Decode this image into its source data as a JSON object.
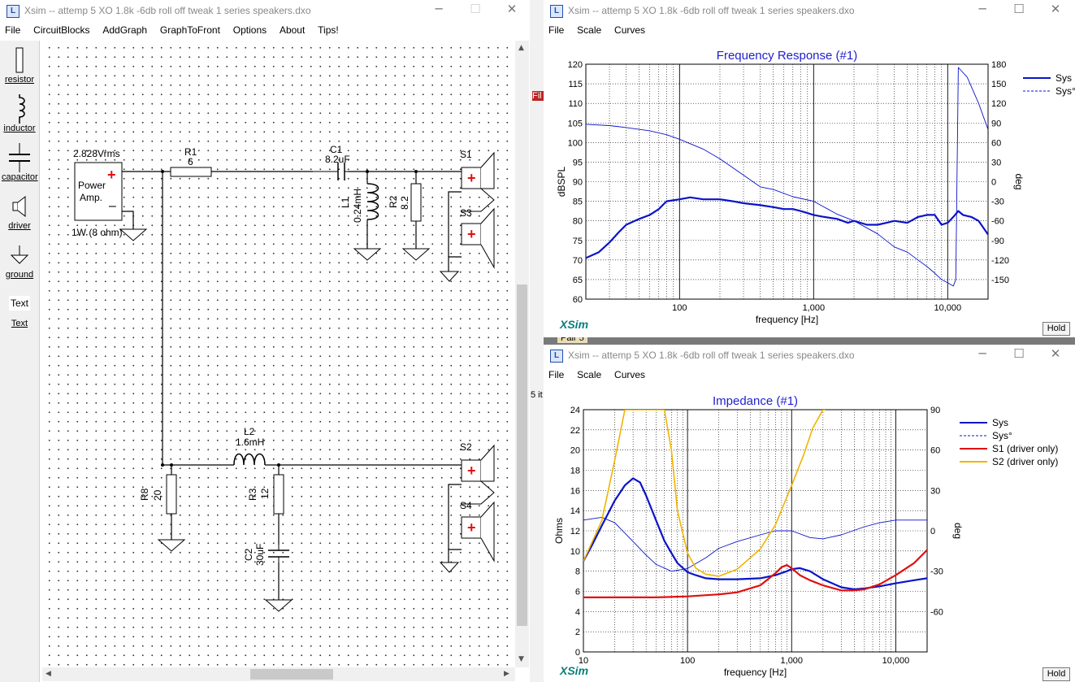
{
  "schematic_window": {
    "title": "Xsim -- attemp 5 XO 1.8k -6db roll off tweak 1 series speakers.dxo",
    "menu": [
      "File",
      "CircuitBlocks",
      "AddGraph",
      "GraphToFront",
      "Options",
      "About",
      "Tips!"
    ],
    "tools": [
      {
        "label": "resistor",
        "icon": "resistor-icon"
      },
      {
        "label": "inductor",
        "icon": "inductor-icon"
      },
      {
        "label": "capacitor",
        "icon": "capacitor-icon"
      },
      {
        "label": "driver",
        "icon": "driver-icon"
      },
      {
        "label": "ground",
        "icon": "ground-icon"
      },
      {
        "label": "Text",
        "icon": "text-icon"
      }
    ],
    "tools_extra_label": "Text",
    "circuit": {
      "source": {
        "voltage": "2.828Vrms",
        "name_line1": "Power",
        "name_line2": "Amp.",
        "power": "1W (8 ohm)"
      },
      "R1": {
        "name": "R1",
        "value": "6"
      },
      "C1": {
        "name": "C1",
        "value": "8.2uF"
      },
      "L1": {
        "name": "L1",
        "value": "0.24mH"
      },
      "R2": {
        "name": "R2",
        "value": "8.2"
      },
      "S1": "S1",
      "S3": "S3",
      "L2": {
        "name": "L2",
        "value": "1.6mH"
      },
      "R8": {
        "name": "R8",
        "value": "20"
      },
      "R3": {
        "name": "R3",
        "value": "12"
      },
      "C2": {
        "name": "C2",
        "value": "30uF"
      },
      "S2": "S2",
      "S4": "S4"
    }
  },
  "freq_window": {
    "title": "Xsim -- attemp 5 XO 1.8k -6db roll off tweak 1 series speakers.dxo",
    "menu": [
      "File",
      "Scale",
      "Curves"
    ],
    "hold": "Hold",
    "brand": "XSim"
  },
  "imp_window": {
    "title": "Xsim -- attemp 5 XO 1.8k -6db roll off tweak 1 series speakers.dxo",
    "menu": [
      "File",
      "Scale",
      "Curves"
    ],
    "hold": "Hold",
    "brand": "XSim"
  },
  "background_peek": {
    "a": "Fil",
    "b": "Pair 5",
    "c": "5 it"
  },
  "colors": {
    "blue": "#0a14c8",
    "red": "#e01010",
    "orange": "#f0b400",
    "title_blue": "#1e1ed0"
  },
  "chart_data": [
    {
      "type": "line",
      "title": "Frequency Response (#1)",
      "xlabel": "frequency [Hz]",
      "ylabel": "dBSPL",
      "y2label": "deg",
      "x_scale": "log",
      "xlim": [
        20,
        20000
      ],
      "ylim": [
        60,
        120
      ],
      "y2lim": [
        -180,
        180
      ],
      "x_ticks": [
        "100",
        "1,000",
        "10,000"
      ],
      "y_ticks": [
        "120",
        "115",
        "110",
        "105",
        "100",
        "95",
        "90",
        "85",
        "80",
        "75",
        "70",
        "65",
        "60"
      ],
      "y2_ticks": [
        "180",
        "150",
        "120",
        "90",
        "60",
        "30",
        "0",
        "-30",
        "-60",
        "-90",
        "-120",
        "-150"
      ],
      "grid": true,
      "legend": "top-right",
      "series": [
        {
          "name": "Sys",
          "color": "#0a14c8",
          "axis": "left",
          "style": "solid-thick",
          "x": [
            20,
            25,
            30,
            35,
            40,
            50,
            60,
            70,
            80,
            100,
            120,
            150,
            200,
            250,
            300,
            400,
            500,
            600,
            700,
            800,
            1000,
            1200,
            1500,
            1800,
            2000,
            2500,
            3000,
            3500,
            4000,
            5000,
            6000,
            7000,
            8000,
            9000,
            10000,
            11000,
            12000,
            13000,
            15000,
            17000,
            20000
          ],
          "y": [
            70.5,
            72,
            74.5,
            77,
            79,
            80.5,
            81.5,
            83,
            85,
            85.5,
            86,
            85.5,
            85.5,
            85,
            84.5,
            84,
            83.5,
            83,
            83,
            82.5,
            81.5,
            81,
            80.5,
            79.5,
            80,
            79,
            79,
            79.5,
            80,
            79.5,
            81,
            81.5,
            81.5,
            79,
            79.5,
            81,
            82.5,
            81.5,
            81,
            80,
            76.5
          ]
        },
        {
          "name": "Sys°",
          "color": "#0a14c8",
          "axis": "right",
          "style": "dashed",
          "x": [
            20,
            30,
            40,
            60,
            80,
            100,
            150,
            200,
            300,
            400,
            500,
            700,
            1000,
            1500,
            2000,
            3000,
            4000,
            5000,
            6000,
            7000,
            8000,
            9000,
            10000,
            11000,
            11500,
            12000,
            14000,
            17000,
            20000
          ],
          "y": [
            88,
            86,
            83,
            78,
            72,
            65,
            50,
            35,
            10,
            -8,
            -12,
            -23,
            -30,
            -50,
            -60,
            -80,
            -100,
            -108,
            -120,
            -130,
            -140,
            -150,
            -155,
            -160,
            -150,
            175,
            160,
            120,
            80
          ]
        }
      ]
    },
    {
      "type": "line",
      "title": "Impedance (#1)",
      "xlabel": "frequency [Hz]",
      "ylabel": "Ohms",
      "y2label": "deg",
      "x_scale": "log",
      "xlim": [
        10,
        20000
      ],
      "ylim": [
        0,
        24
      ],
      "y2lim": [
        -90,
        90
      ],
      "x_ticks": [
        "10",
        "100",
        "1,000",
        "10,000"
      ],
      "y_ticks": [
        "24",
        "22",
        "20",
        "18",
        "16",
        "14",
        "12",
        "10",
        "8",
        "6",
        "4",
        "2",
        "0"
      ],
      "y2_ticks": [
        "90",
        "60",
        "30",
        "0",
        "-30",
        "-60"
      ],
      "grid": true,
      "legend": "top-right",
      "series": [
        {
          "name": "Sys",
          "color": "#0a14c8",
          "axis": "left",
          "style": "solid-thick",
          "x": [
            10,
            12,
            15,
            20,
            25,
            30,
            35,
            40,
            50,
            60,
            70,
            80,
            100,
            120,
            150,
            200,
            300,
            500,
            700,
            900,
            1000,
            1200,
            1500,
            2000,
            3000,
            4000,
            5000,
            7000,
            10000,
            15000,
            20000
          ],
          "y": [
            9,
            10.5,
            12.5,
            15,
            16.5,
            17.2,
            16.8,
            15.5,
            13,
            11,
            9.8,
            8.8,
            7.9,
            7.6,
            7.3,
            7.2,
            7.2,
            7.3,
            7.6,
            8,
            8.2,
            8.3,
            8,
            7.2,
            6.4,
            6.2,
            6.3,
            6.5,
            6.8,
            7.1,
            7.3
          ]
        },
        {
          "name": "Sys°",
          "color": "#0a14c8",
          "axis": "right",
          "style": "dashed",
          "x": [
            10,
            15,
            20,
            30,
            40,
            50,
            70,
            100,
            150,
            200,
            300,
            500,
            700,
            1000,
            1500,
            2000,
            3000,
            5000,
            7000,
            10000,
            15000,
            20000
          ],
          "y": [
            8,
            10,
            6,
            -8,
            -18,
            -25,
            -30,
            -28,
            -20,
            -13,
            -8,
            -3,
            0,
            0,
            -5,
            -6,
            -3,
            3,
            6,
            8,
            8,
            8
          ]
        },
        {
          "name": "S1 (driver only)",
          "color": "#e01010",
          "axis": "left",
          "style": "solid-thick",
          "x": [
            10,
            20,
            50,
            100,
            200,
            300,
            500,
            700,
            800,
            900,
            1000,
            1200,
            1500,
            2000,
            3000,
            4000,
            5000,
            7000,
            10000,
            15000,
            20000
          ],
          "y": [
            5.4,
            5.4,
            5.4,
            5.5,
            5.7,
            5.9,
            6.6,
            7.8,
            8.4,
            8.6,
            8.3,
            7.6,
            7.1,
            6.6,
            6.1,
            6.1,
            6.2,
            6.7,
            7.6,
            8.8,
            10.1
          ]
        },
        {
          "name": "S2 (driver only)",
          "color": "#f0b400",
          "axis": "left",
          "style": "solid",
          "x": [
            10,
            15,
            20,
            25,
            30,
            35,
            40,
            50,
            60,
            70,
            80,
            100,
            120,
            150,
            200,
            300,
            500,
            700,
            1000,
            1300,
            1600,
            2000,
            2100
          ],
          "y": [
            9,
            13,
            19,
            24,
            24,
            24,
            24,
            24,
            24,
            20,
            14,
            9.8,
            8.3,
            7.7,
            7.5,
            8.2,
            10.2,
            12.6,
            16.5,
            19.5,
            22.2,
            24,
            24
          ]
        }
      ]
    }
  ]
}
